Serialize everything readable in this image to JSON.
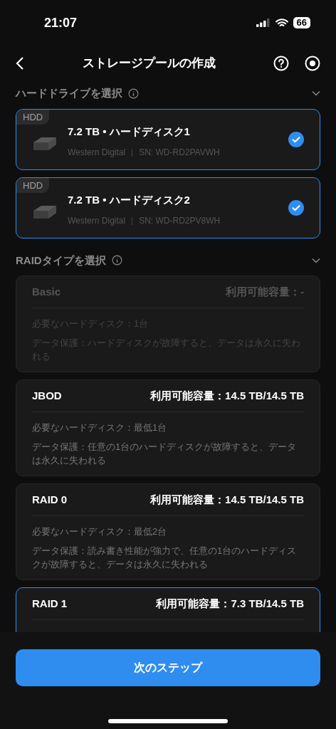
{
  "status_bar": {
    "time": "21:07",
    "battery": "66"
  },
  "nav": {
    "title": "ストレージプールの作成"
  },
  "drive_section": {
    "title": "ハードドライブを選択",
    "expanded": true
  },
  "drives": [
    {
      "tag": "HDD",
      "name": "7.2 TB • ハードディスク1",
      "vendor": "Western Digital",
      "serial": "SN: WD-RD2PAVWH",
      "selected": true
    },
    {
      "tag": "HDD",
      "name": "7.2 TB • ハードディスク2",
      "vendor": "Western Digital",
      "serial": "SN: WD-RD2PV8WH",
      "selected": true
    }
  ],
  "raid_section": {
    "title": "RAIDタイプを選択",
    "expanded": true
  },
  "raid_types": [
    {
      "name": "Basic",
      "capacity": "利用可能容量：-",
      "disabled": true,
      "selected": false,
      "lines": [
        "必要なハードディスク：1台",
        "データ保護：ハードディスクが故障すると、データは永久に失われる"
      ]
    },
    {
      "name": "JBOD",
      "capacity": "利用可能容量：14.5 TB/14.5 TB",
      "disabled": false,
      "selected": false,
      "lines": [
        "必要なハードディスク：最低1台",
        "データ保護：任意の1台のハードディスクが故障すると、データは永久に失われる"
      ]
    },
    {
      "name": "RAID 0",
      "capacity": "利用可能容量：14.5 TB/14.5 TB",
      "disabled": false,
      "selected": false,
      "lines": [
        "必要なハードディスク：最低2台",
        "データ保護：読み書き性能が強力で、任意の1台のハードディスクが故障すると、データは永久に失われる"
      ]
    },
    {
      "name": "RAID 1",
      "capacity": "利用可能容量：7.3 TB/14.5 TB",
      "disabled": false,
      "selected": true
    }
  ],
  "next_button": "次のステップ"
}
